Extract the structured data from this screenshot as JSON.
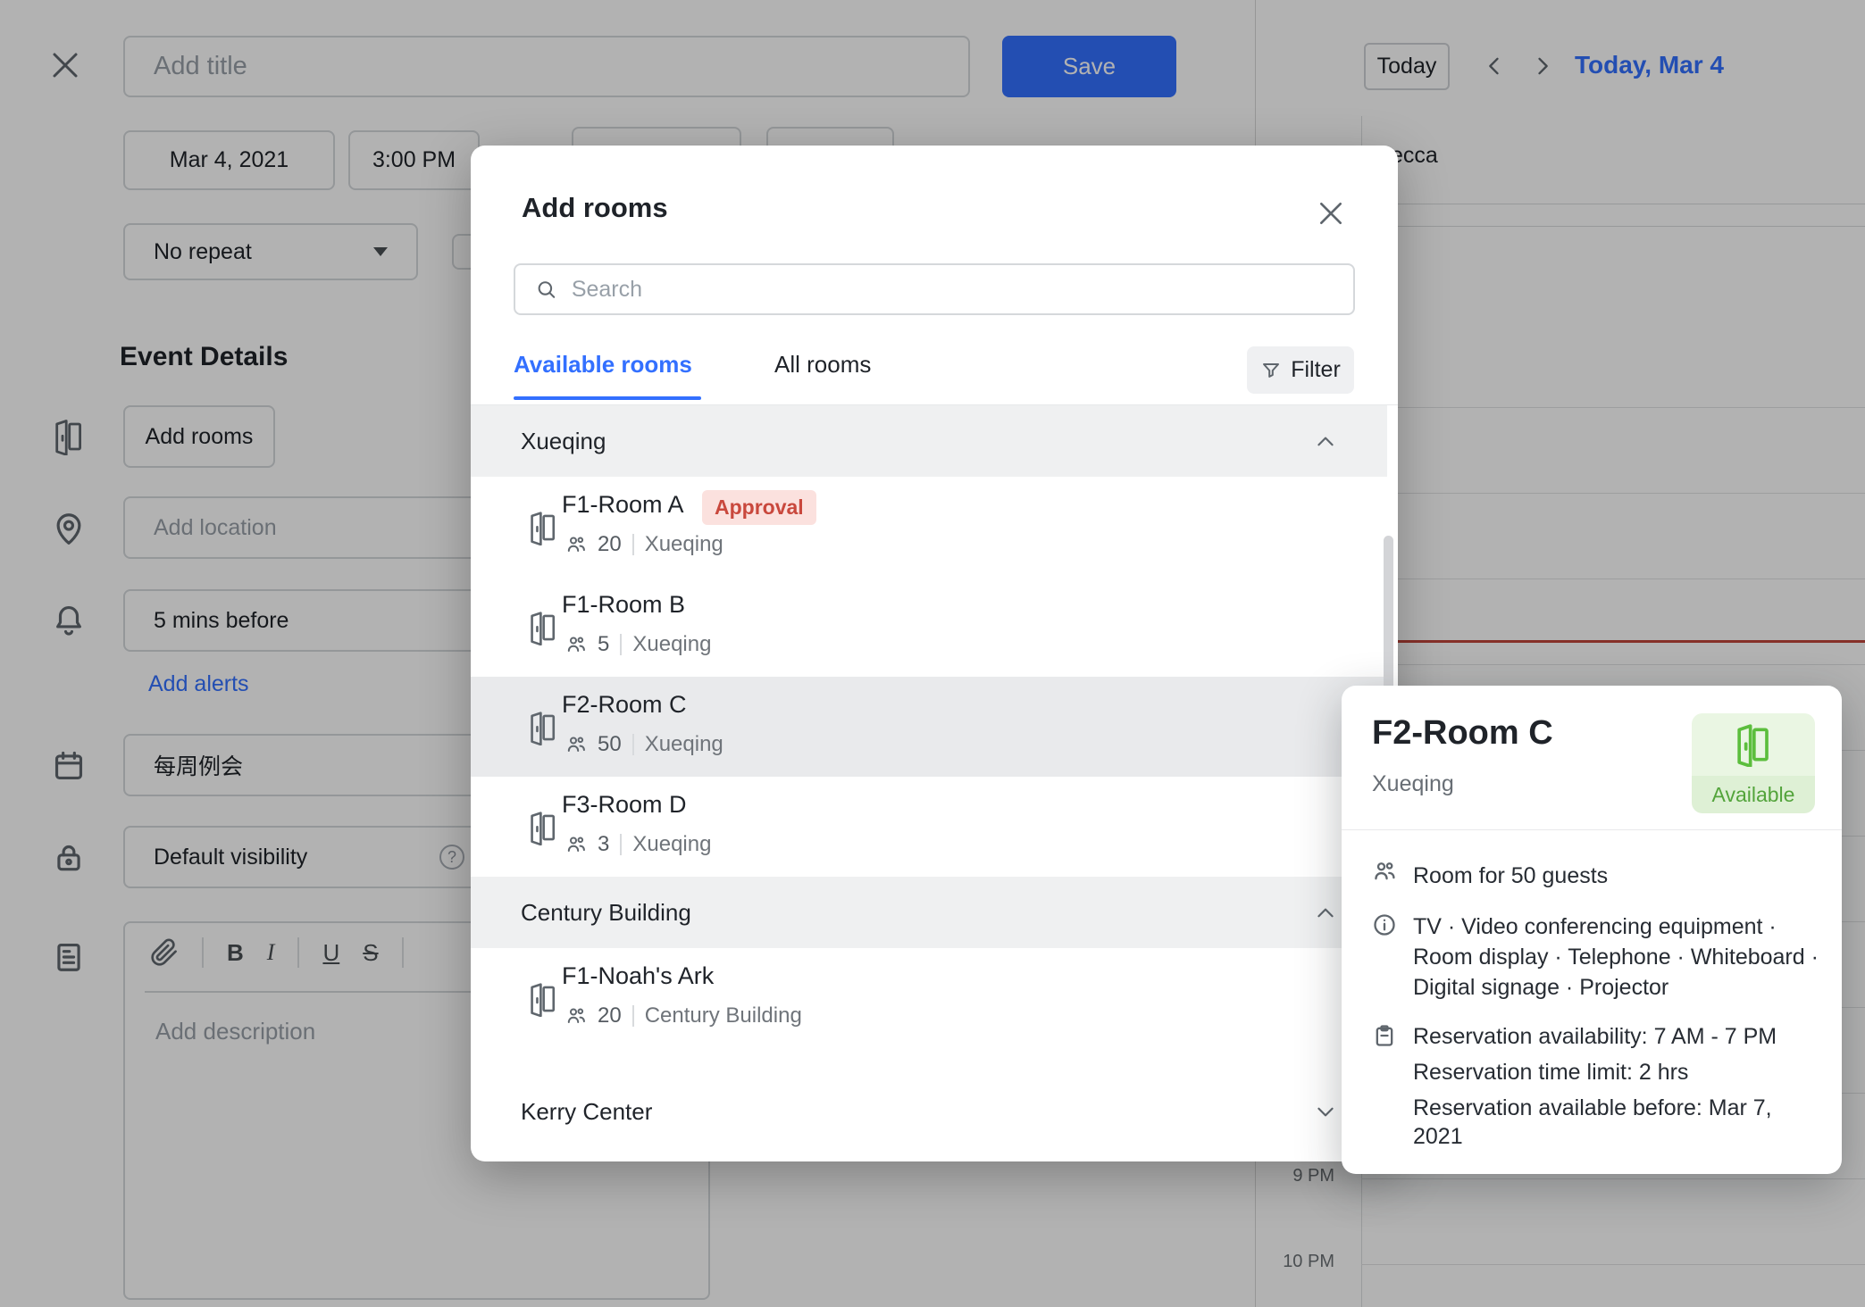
{
  "colors": {
    "accent_blue": "#3370ff",
    "text_primary": "#1f2329",
    "text_secondary": "#646a73",
    "placeholder_gray": "#98a0a8",
    "approval_badge_bg": "#fbe1de",
    "approval_badge_text": "#c9483d",
    "available_green": "#53a43b",
    "available_icon_green": "#5cbe3d",
    "row_hover_gray": "#e9eaec",
    "group_header_gray": "#eff0f1",
    "current_time_red": "#c0463c"
  },
  "form": {
    "title_placeholder": "Add title",
    "save_label": "Save",
    "date_value": "Mar 4, 2021",
    "time_value": "3:00 PM",
    "repeat_value": "No repeat",
    "section_heading": "Event Details",
    "add_rooms_label": "Add rooms",
    "location_placeholder": "Add location",
    "alert_value": "5 mins before",
    "add_alerts_label": "Add alerts",
    "meeting_calendar_value": "每周例会",
    "visibility_value": "Default visibility",
    "help_glyph": "?",
    "toolbar": {
      "bold": "B",
      "italic": "I",
      "underline": "U",
      "strikethrough": "S"
    },
    "description_placeholder": "Add description"
  },
  "calendar": {
    "today_button": "Today",
    "header_date": "Today, Mar 4",
    "allday_event_partial": "ecca",
    "time_labels": [
      "9 PM",
      "10 PM"
    ]
  },
  "modal": {
    "title": "Add rooms",
    "search_placeholder": "Search",
    "tabs": [
      {
        "label": "Available rooms",
        "active": true
      },
      {
        "label": "All rooms",
        "active": false
      }
    ],
    "filter_label": "Filter",
    "groups": [
      {
        "name": "Xueqing",
        "expanded": true,
        "rooms": [
          {
            "name": "F1-Room A",
            "badge": "Approval",
            "capacity": "20",
            "building": "Xueqing"
          },
          {
            "name": "F1-Room B",
            "capacity": "5",
            "building": "Xueqing"
          },
          {
            "name": "F2-Room C",
            "capacity": "50",
            "building": "Xueqing",
            "highlighted": true
          },
          {
            "name": "F3-Room D",
            "capacity": "3",
            "building": "Xueqing"
          }
        ]
      },
      {
        "name": "Century Building",
        "expanded": true,
        "rooms": [
          {
            "name": "F1-Noah's Ark",
            "capacity": "20",
            "building": "Century Building"
          }
        ]
      },
      {
        "name": "Kerry Center",
        "expanded": false,
        "rooms": []
      }
    ]
  },
  "tooltip": {
    "room_name": "F2-Room C",
    "building": "Xueqing",
    "status_label": "Available",
    "capacity_text": "Room for 50 guests",
    "equipment_text": "TV · Video conferencing equipment · Room display · Telephone · Whiteboard · Digital signage · Projector",
    "reservation_lines": [
      "Reservation availability: 7 AM - 7 PM",
      "Reservation time limit: 2 hrs",
      "Reservation available before: Mar 7, 2021"
    ]
  }
}
